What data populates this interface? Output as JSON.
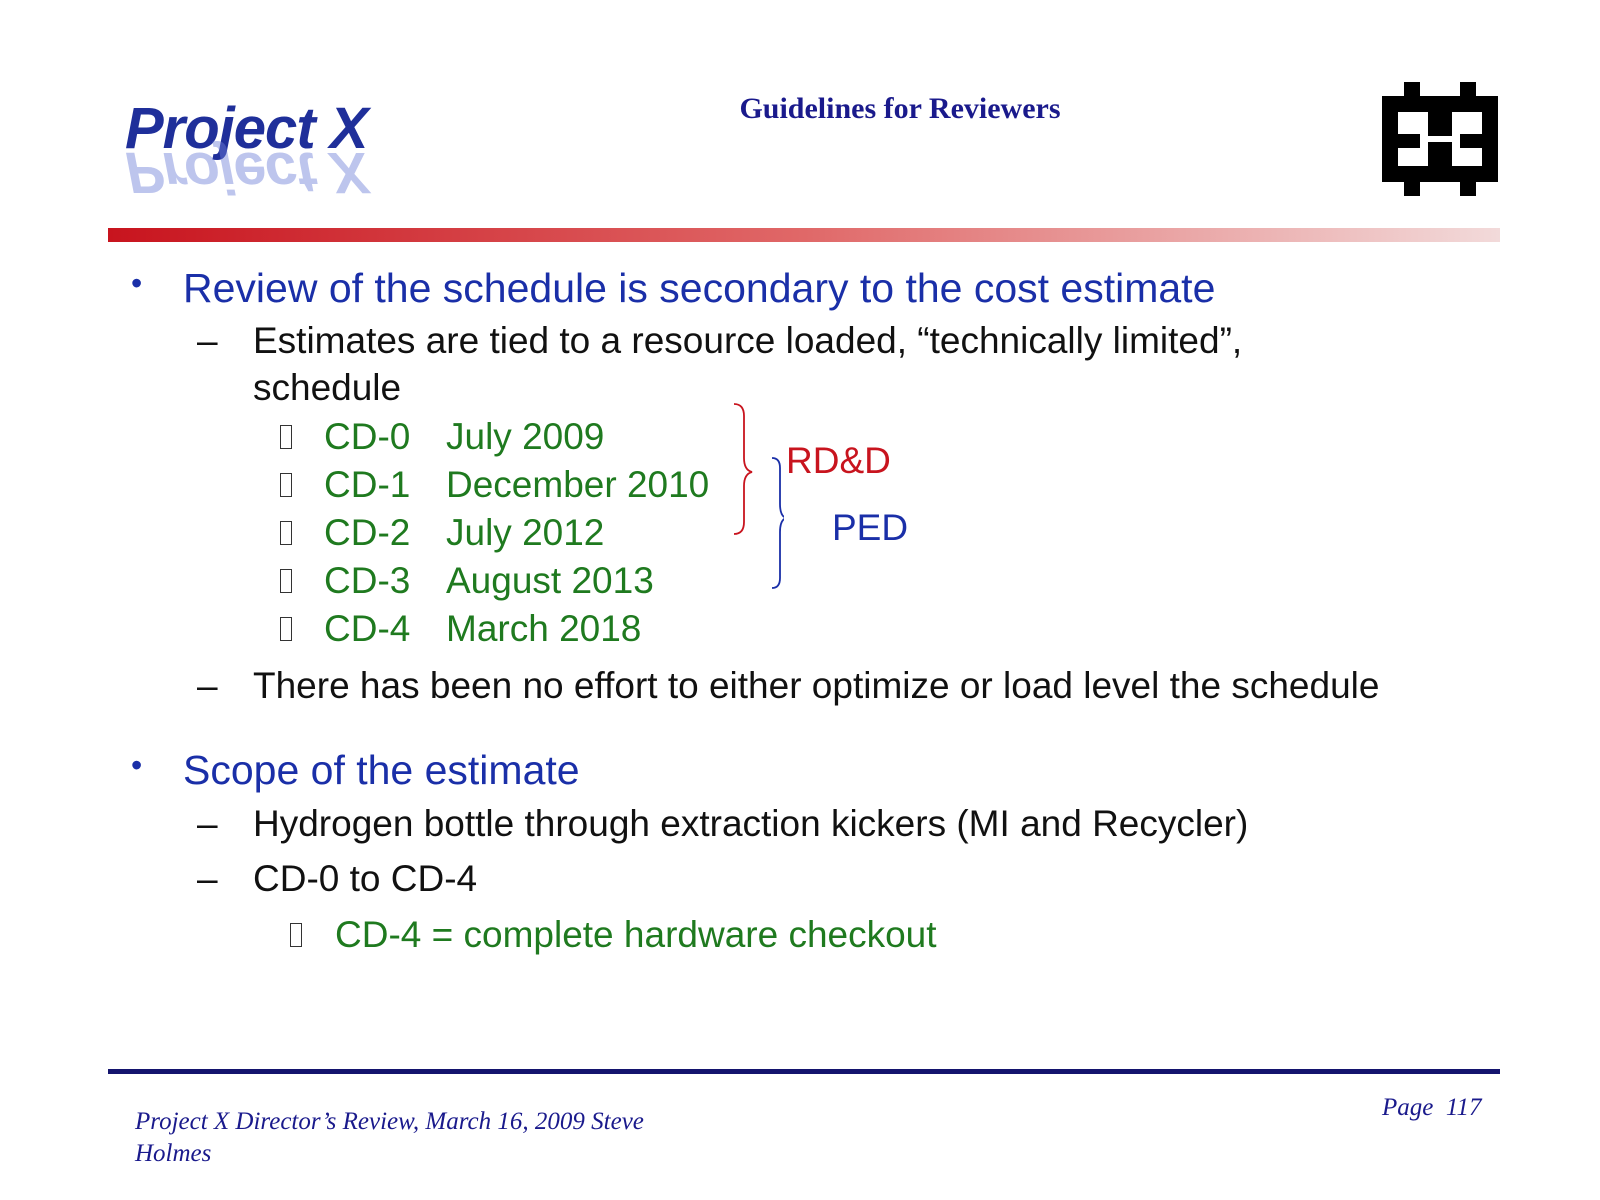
{
  "header": {
    "logo_text": "Project X",
    "title": "Guidelines for Reviewers",
    "fermilab_logo_icon": "fermilab-logo-icon"
  },
  "colors": {
    "header_bar_start": "#c8141e",
    "footer_bar": "#14146e",
    "bullet_blue": "#1a2fa8",
    "green": "#1f7a1f",
    "red": "#c8141e"
  },
  "sections": [
    {
      "bullet": "Review of the schedule is secondary to the cost estimate",
      "subs": [
        {
          "line1": "Estimates are tied to a resource loaded, “technically limited”,",
          "line2": "schedule"
        },
        {
          "line1": "There has been no effort to either optimize or load level the schedule"
        }
      ],
      "milestones": [
        {
          "code": "CD-0",
          "date": "July 2009"
        },
        {
          "code": "CD-1",
          "date": "December 2010"
        },
        {
          "code": "CD-2",
          "date": "July 2012"
        },
        {
          "code": "CD-3",
          "date": "August 2013"
        },
        {
          "code": "CD-4",
          "date": "March 2018"
        }
      ],
      "phase_labels": {
        "rdd": "RD&D",
        "ped": "PED"
      }
    },
    {
      "bullet": "Scope of the estimate",
      "subs": [
        {
          "line1": "Hydrogen bottle through extraction kickers (MI and Recycler)"
        },
        {
          "line1": "CD-0 to CD-4"
        }
      ],
      "note": "CD-4 = complete hardware checkout"
    }
  ],
  "footer": {
    "left_line1": "Project X Director’s Review, March 16, 2009   Steve",
    "left_line2": "Holmes",
    "page": "Page  117"
  }
}
